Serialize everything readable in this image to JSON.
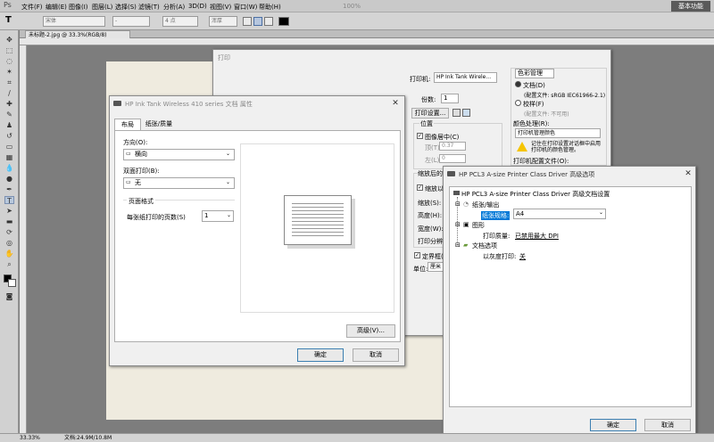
{
  "app": {
    "logo": "Ps",
    "menus": [
      "文件(F)",
      "编辑(E)",
      "图像(I)",
      "图层(L)",
      "选择(S)",
      "滤镜(T)",
      "分析(A)",
      "3D(D)",
      "视图(V)",
      "窗口(W)",
      "帮助(H)"
    ],
    "workspace": "基本功能",
    "zoom": "100%"
  },
  "options": {
    "font_family": "宋体",
    "font_style": "-",
    "font_size": "4 点",
    "antialias": "浑厚"
  },
  "document": {
    "tab_title": "未标题-2.jpg @ 33.3%(RGB/8)",
    "status_zoom": "33.33%",
    "status_doc": "文档:24.9M/10.8M"
  },
  "print_dialog": {
    "title": "打印",
    "printer_label": "打印机:",
    "printer_value": "HP Ink Tank Wirele...",
    "copies_label": "份数:",
    "copies_value": "1",
    "print_settings_button": "打印设置...",
    "position_title": "位置",
    "center_image": "图像居中(C)",
    "top_label": "顶(T):",
    "top_value": "0.37",
    "left_label": "左(L):",
    "left_value": "0",
    "scaled_title": "缩放后的打印尺寸",
    "scale_to_fit": "缩放以适合介质(M)",
    "scale_label": "缩放(S):",
    "height_label": "高度(H):",
    "width_label": "宽度(W):",
    "resolution_label": "打印分辨率:",
    "bounding_box": "定界框(B)",
    "units_label": "单位:",
    "units_value": "厘米",
    "color_mgmt": "色彩管理",
    "doc_radio": "文档(D)",
    "doc_profile": "(配置文件: sRGB IEC61966-2.1)",
    "proof_radio": "校样(F)",
    "proof_profile": "(配置文件: 不可用)",
    "color_handling_label": "颜色处理(R):",
    "color_handling_value": "打印机管理颜色",
    "warning_text": "记住在打印设置对话框中启用打印机的颜色管理。",
    "printer_profile_label": "打印机配置文件(O):"
  },
  "props_dialog": {
    "title": "HP Ink Tank Wireless 410 series 文档 属性",
    "tabs": [
      "布局",
      "纸张/质量"
    ],
    "orientation_label": "方向(O):",
    "orientation_value": "横向",
    "duplex_label": "双面打印(B):",
    "duplex_value": "无",
    "page_format_label": "页面格式",
    "pages_per_sheet_label": "每张纸打印的页数(S)",
    "pages_per_sheet_value": "1",
    "advanced_button": "高级(V)...",
    "ok": "确定",
    "cancel": "取消"
  },
  "adv_dialog": {
    "title": "HP PCL3 A-size Printer Class Driver 高级选项",
    "root": "HP PCL3 A-size Printer Class Driver 高级文档设置",
    "paper_output": "纸张/输出",
    "paper_size_label": "纸张规格:",
    "paper_size_value": "A4",
    "graphic": "图形",
    "print_quality_label": "打印质量:",
    "print_quality_value": "已禁用最大 DPI",
    "doc_options": "文档选项",
    "grayscale_label": "以灰度打印:",
    "grayscale_value": "关",
    "ok": "确定",
    "cancel": "取消"
  },
  "colors": {
    "ps_menubar": "#c9c9c9",
    "ps_canvas_bg": "#7d7d7d",
    "artboard": "#efebdf",
    "dialog_bg": "#f0f0f0",
    "select_highlight": "#0078d7"
  },
  "icons": [
    "printer-icon",
    "warning-icon",
    "expand-icon",
    "folder-icon",
    "close-icon",
    "chevron-down-icon"
  ]
}
